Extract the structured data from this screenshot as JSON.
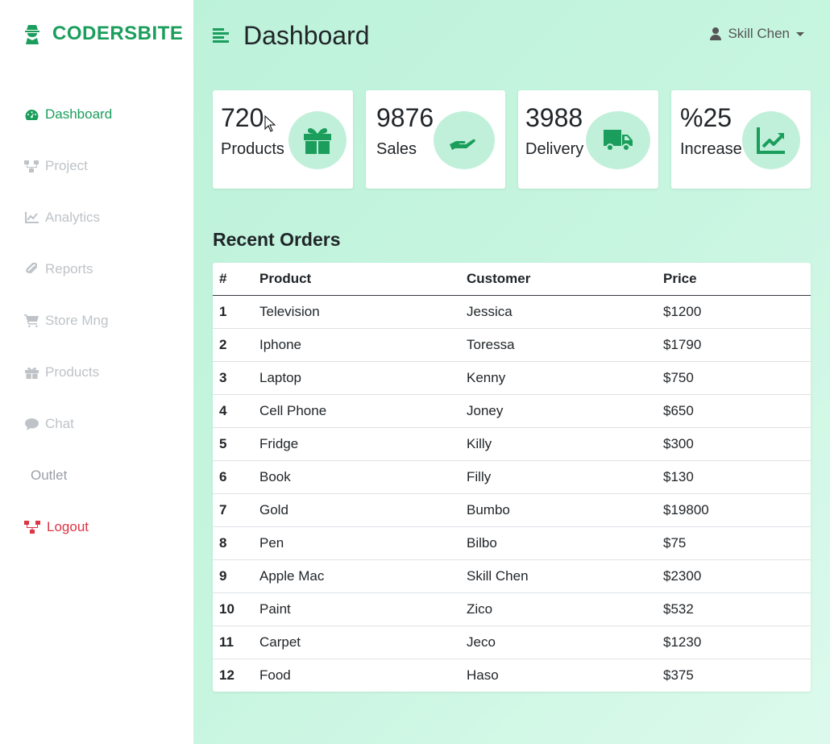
{
  "brand": {
    "name": "CODERSBITE",
    "icon": "user-secret-icon"
  },
  "colors": {
    "accent": "#1b9e5c",
    "danger": "#dc3545",
    "muted": "#bfc3c7",
    "bg": "#c7f5e0",
    "circle": "#c1f0da"
  },
  "sidebar": {
    "items": [
      {
        "label": "Dashboard",
        "icon": "tachometer-icon",
        "state": "active"
      },
      {
        "label": "Project",
        "icon": "sitemap-icon"
      },
      {
        "label": "Analytics",
        "icon": "line-chart-icon"
      },
      {
        "label": "Reports",
        "icon": "paperclip-icon"
      },
      {
        "label": "Store Mng",
        "icon": "shopping-cart-icon"
      },
      {
        "label": "Products",
        "icon": "gift-icon"
      },
      {
        "label": "Chat",
        "icon": "comment-icon"
      },
      {
        "label": "Outlet"
      },
      {
        "label": "Logout",
        "icon": "sitemap-icon",
        "state": "danger"
      }
    ]
  },
  "header": {
    "title": "Dashboard",
    "menu_icon": "align-left-icon"
  },
  "user": {
    "name": "Skill Chen",
    "icon": "user-icon"
  },
  "cards": [
    {
      "value": "720",
      "label": "Products",
      "icon": "gift-icon"
    },
    {
      "value": "9876",
      "label": "Sales",
      "icon": "hand-holding-icon"
    },
    {
      "value": "3988",
      "label": "Delivery",
      "icon": "truck-icon"
    },
    {
      "value": "%25",
      "label": "Increase",
      "icon": "chart-line-icon"
    }
  ],
  "orders": {
    "title": "Recent Orders",
    "columns": [
      "#",
      "Product",
      "Customer",
      "Price"
    ],
    "rows": [
      [
        "1",
        "Television",
        "Jessica",
        "$1200"
      ],
      [
        "2",
        "Iphone",
        "Toressa",
        "$1790"
      ],
      [
        "3",
        "Laptop",
        "Kenny",
        "$750"
      ],
      [
        "4",
        "Cell Phone",
        "Joney",
        "$650"
      ],
      [
        "5",
        "Fridge",
        "Killy",
        "$300"
      ],
      [
        "6",
        "Book",
        "Filly",
        "$130"
      ],
      [
        "7",
        "Gold",
        "Bumbo",
        "$19800"
      ],
      [
        "8",
        "Pen",
        "Bilbo",
        "$75"
      ],
      [
        "9",
        "Apple Mac",
        "Skill Chen",
        "$2300"
      ],
      [
        "10",
        "Paint",
        "Zico",
        "$532"
      ],
      [
        "11",
        "Carpet",
        "Jeco",
        "$1230"
      ],
      [
        "12",
        "Food",
        "Haso",
        "$375"
      ]
    ]
  }
}
